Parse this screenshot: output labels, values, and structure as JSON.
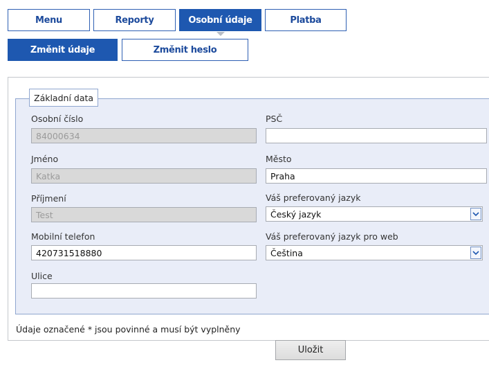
{
  "nav": {
    "tabs": [
      {
        "label": "Menu"
      },
      {
        "label": "Reporty"
      },
      {
        "label": "Osobní údaje"
      },
      {
        "label": "Platba"
      }
    ],
    "subtabs": [
      {
        "label": "Změnit údaje"
      },
      {
        "label": "Změnit heslo"
      }
    ]
  },
  "form": {
    "legend": "Základní data",
    "personal_number": {
      "label": "Osobní číslo",
      "value": "84000634"
    },
    "first_name": {
      "label": "Jméno",
      "value": "Katka"
    },
    "last_name": {
      "label": "Příjmení",
      "value": "Test"
    },
    "mobile": {
      "label": "Mobilní telefon",
      "value": "420731518880"
    },
    "street": {
      "label": "Ulice",
      "value": ""
    },
    "zip": {
      "label": "PSČ",
      "value": ""
    },
    "city": {
      "label": "Město",
      "value": "Praha"
    },
    "language": {
      "label": "Váš preferovaný jazyk",
      "value": "Český jazyk"
    },
    "web_language": {
      "label": "Váš preferovaný jazyk pro web",
      "value": "Čeština"
    }
  },
  "footer": {
    "note": "Údaje označené * jsou povinné a musí být vyplněny",
    "save_label": "Uložit"
  },
  "colors": {
    "accent": "#1e58b0",
    "fieldset_bg": "#e9edf8",
    "disabled_bg": "#d9d9d9"
  }
}
